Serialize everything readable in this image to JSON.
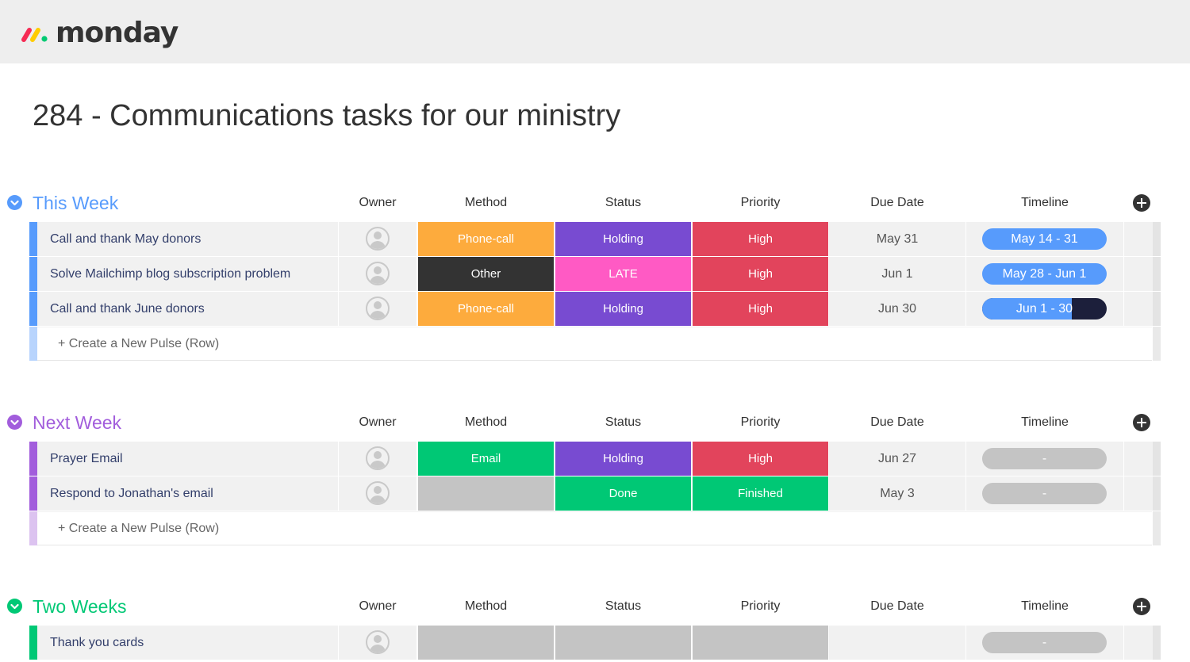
{
  "app": {
    "logo_text": "monday"
  },
  "board": {
    "title": "284 - Communications tasks for our ministry"
  },
  "columns": {
    "owner": "Owner",
    "method": "Method",
    "status": "Status",
    "priority": "Priority",
    "due_date": "Due Date",
    "timeline": "Timeline"
  },
  "colors": {
    "group_this_week": "#579bfc",
    "group_next_week": "#a25ddc",
    "group_two_weeks": "#00c875",
    "method_phone_call": "#fdab3d",
    "method_other": "#333333",
    "method_email": "#00c875",
    "status_holding": "#784bd1",
    "status_late": "#ff5ac4",
    "status_done": "#00c875",
    "priority_high": "#e2445c",
    "priority_finished": "#00c875",
    "empty_label": "#c4c4c4",
    "timeline_blue": "#579bfc",
    "timeline_dark": "#1c1f3b",
    "timeline_empty": "#c4c4c4"
  },
  "groups": [
    {
      "title": "This Week",
      "new_row_label": "+ Create a New Pulse (Row)",
      "rows": [
        {
          "name": "Call and thank May donors",
          "method": "Phone-call",
          "status": "Holding",
          "priority": "High",
          "due": "May 31",
          "timeline": "May 14 - 31",
          "timeline_progress": 1.0
        },
        {
          "name": "Solve Mailchimp blog subscription problem",
          "method": "Other",
          "status": "LATE",
          "priority": "High",
          "due": "Jun 1",
          "timeline": "May 28 - Jun 1",
          "timeline_progress": 1.0
        },
        {
          "name": "Call and thank June donors",
          "method": "Phone-call",
          "status": "Holding",
          "priority": "High",
          "due": "Jun 30",
          "timeline": "Jun 1 - 30",
          "timeline_progress": 0.72
        }
      ]
    },
    {
      "title": "Next Week",
      "new_row_label": "+ Create a New Pulse (Row)",
      "rows": [
        {
          "name": "Prayer Email",
          "method": "Email",
          "status": "Holding",
          "priority": "High",
          "due": "Jun 27",
          "timeline": "-",
          "timeline_progress": 0
        },
        {
          "name": "Respond to Jonathan's email",
          "method": "",
          "status": "Done",
          "priority": "Finished",
          "due": "May 3",
          "timeline": "-",
          "timeline_progress": 0
        }
      ]
    },
    {
      "title": "Two Weeks",
      "rows": [
        {
          "name": "Thank you cards",
          "method": "",
          "status": "",
          "priority": "",
          "due": "",
          "timeline": "-",
          "timeline_progress": 0
        }
      ]
    }
  ]
}
